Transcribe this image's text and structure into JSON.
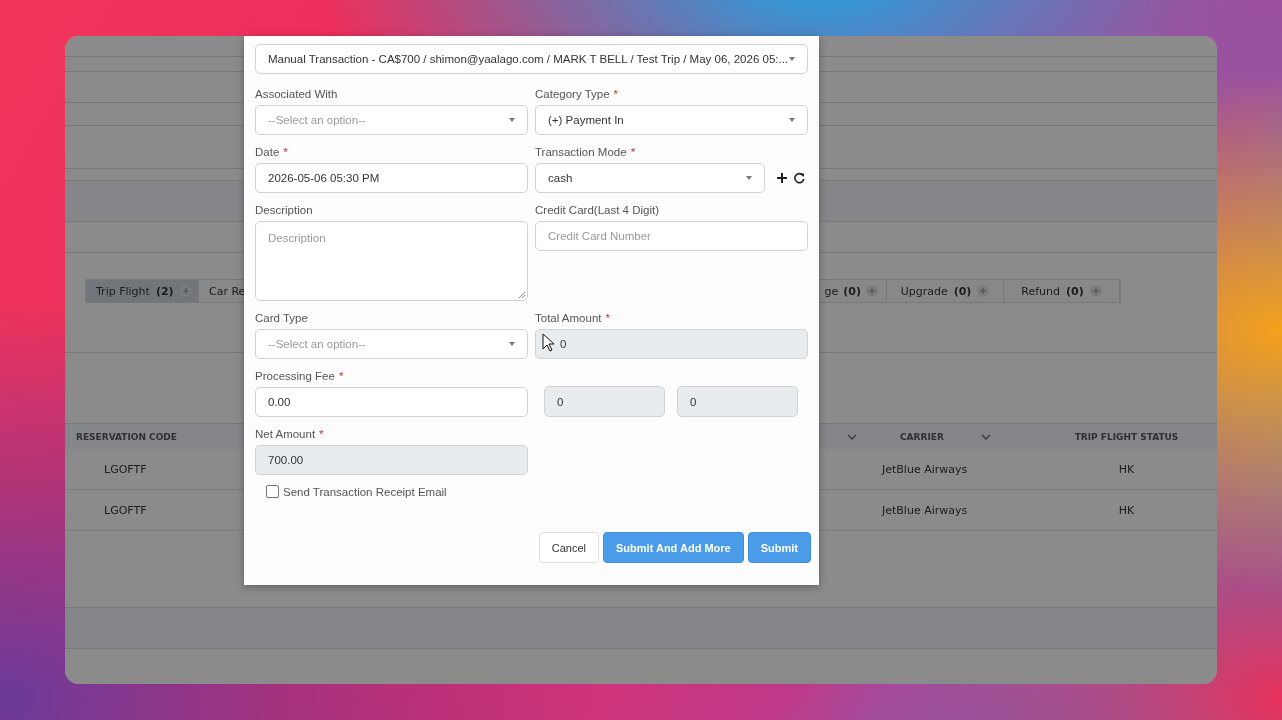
{
  "background_page": {
    "tabs": [
      {
        "label": "Trip Flight",
        "count": "(2)",
        "has_add": true,
        "selected": true
      },
      {
        "label": "Car Re",
        "has_add": false,
        "selected": false
      },
      {
        "label": "ge",
        "count": "(0)",
        "has_add": true,
        "selected": false
      },
      {
        "label": "Upgrade",
        "count": "(0)",
        "has_add": true,
        "selected": false
      },
      {
        "label": "Refund",
        "count": "(0)",
        "has_add": true,
        "selected": false
      }
    ],
    "table": {
      "columns": [
        {
          "label": "RESERVATION CODE",
          "sortable": false
        },
        {
          "sortable": true
        },
        {
          "label": "CARRIER",
          "sortable": true
        },
        {
          "label": "TRIP FLIGHT STATUS",
          "sortable": false
        }
      ],
      "rows": [
        {
          "reservation_code": "LGOFTF",
          "carrier": "JetBlue Airways",
          "trip_flight_status": "HK"
        },
        {
          "reservation_code": "LGOFTF",
          "carrier": "JetBlue Airways",
          "trip_flight_status": "HK"
        }
      ]
    }
  },
  "dialog": {
    "transaction": "Manual Transaction - CA$700 / shimon@yaalago.com / MARK T BELL / Test Trip / May 06, 2026 05:...",
    "fields": [
      {
        "kind": "select",
        "label": "Associated With",
        "placeholder": "--Select an option--"
      },
      {
        "kind": "select",
        "label": "Category Type",
        "required_mark": "*",
        "value": "(+) Payment In"
      },
      {
        "kind": "input",
        "label": "Date",
        "required_mark": "*",
        "value": "2026-05-06 05:30 PM"
      },
      {
        "kind": "select",
        "label": "Transaction Mode",
        "required_mark": "*",
        "value": "cash",
        "actions": true
      },
      {
        "kind": "textarea",
        "label": "Description",
        "placeholder": "Description"
      },
      {
        "kind": "input",
        "label": "Credit Card(Last 4 Digit)",
        "placeholder": "Credit Card Number"
      },
      {
        "kind": "select",
        "label": "Card Type",
        "placeholder": "--Select an option--"
      },
      {
        "kind": "input",
        "label": "Total Amount",
        "required_mark": "*",
        "value": "0",
        "readonly": true,
        "cursor": true
      },
      {
        "kind": "input",
        "label": "Processing Fee",
        "required_mark": "*",
        "value": "0.00"
      },
      {
        "kind": "pair",
        "values": [
          "0",
          "0"
        ],
        "readonly": true
      },
      {
        "kind": "input",
        "label": "Net Amount",
        "required_mark": "*",
        "value": "700.00",
        "readonly": true
      }
    ],
    "receipt_email": {
      "label": "Send Transaction Receipt Email",
      "checked": false
    },
    "buttons": [
      {
        "label": "Cancel",
        "kind": "secondary"
      },
      {
        "label": "Submit And Add More",
        "kind": "primary"
      },
      {
        "label": "Submit",
        "kind": "primary"
      }
    ]
  }
}
